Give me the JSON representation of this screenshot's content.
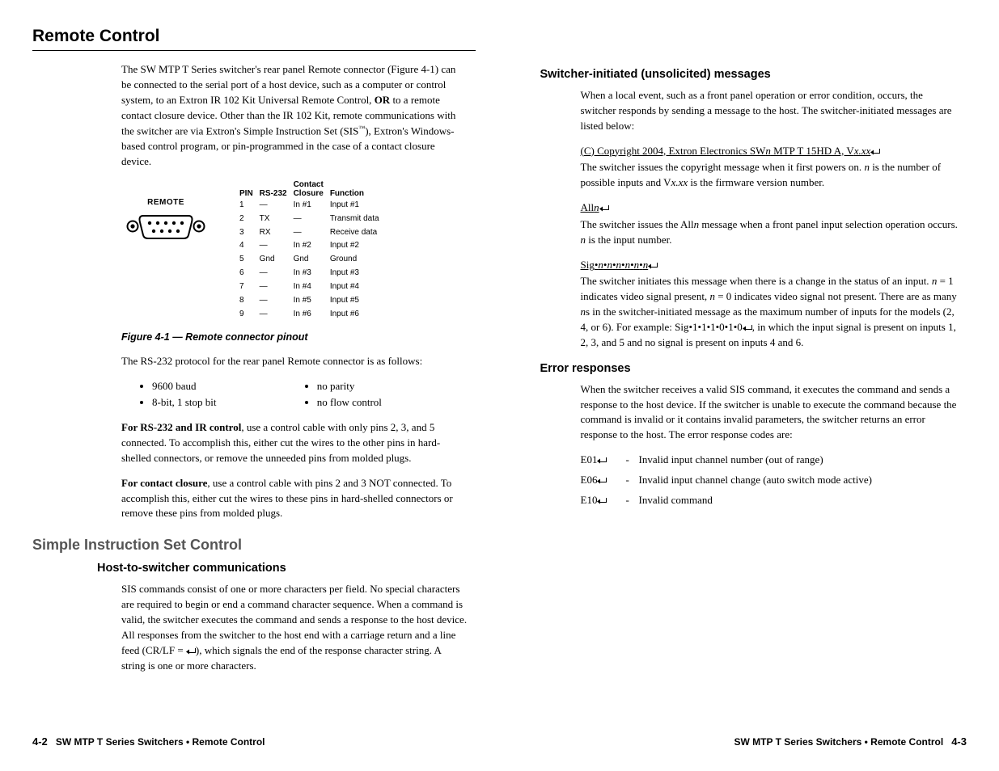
{
  "left": {
    "title": "Remote Control",
    "intro_a": "The SW MTP T Series switcher's rear panel Remote connector (Figure 4-1) can be connected to the serial port of a host device, such as a computer or control system, to an Extron IR 102 Kit Universal Remote Control, ",
    "intro_or": "OR",
    "intro_b": " to a remote contact closure device.  Other than the IR 102 Kit, remote communications with the switcher are via Extron's Simple Instruction Set (SIS",
    "intro_c": "), Extron's Windows-based control program, or pin-programmed in the case of a contact closure device.",
    "remote_label": "REMOTE",
    "pin_headers": {
      "pin": "PIN",
      "rs232": "RS-232",
      "cc1": "Contact",
      "cc2": "Closure",
      "fn": "Function"
    },
    "pins": [
      {
        "n": "1",
        "r": "—",
        "c": "In #1",
        "f": "Input #1"
      },
      {
        "n": "2",
        "r": "TX",
        "c": "—",
        "f": "Transmit data"
      },
      {
        "n": "3",
        "r": "RX",
        "c": "—",
        "f": "Receive data"
      },
      {
        "n": "4",
        "r": "—",
        "c": "In #2",
        "f": "Input #2"
      },
      {
        "n": "5",
        "r": "Gnd",
        "c": "Gnd",
        "f": "Ground"
      },
      {
        "n": "6",
        "r": "—",
        "c": "In #3",
        "f": "Input #3"
      },
      {
        "n": "7",
        "r": "—",
        "c": "In #4",
        "f": "Input #4"
      },
      {
        "n": "8",
        "r": "—",
        "c": "In #5",
        "f": "Input #5"
      },
      {
        "n": "9",
        "r": "—",
        "c": "In #6",
        "f": "Input #6"
      }
    ],
    "figcap": "Figure 4-1 — Remote connector pinout",
    "proto_intro": "The RS-232 protocol for the rear panel Remote connector is as follows:",
    "proto": {
      "a": "9600 baud",
      "b": "8-bit, 1 stop bit",
      "c": "no parity",
      "d": "no flow control"
    },
    "rs232_b": "For RS-232 and IR control",
    "rs232_t": ", use a control cable with only pins 2, 3, and 5 connected.  To accomplish this, either cut the wires to the other pins in hard-shelled connectors, or remove the unneeded pins from molded plugs.",
    "cc_b": "For contact closure",
    "cc_t": ", use a control cable with pins 2 and 3 NOT connected.  To accomplish this, either cut the wires to these pins in hard-shelled connectors or remove these pins from molded plugs.",
    "sis_h2": "Simple Instruction Set Control",
    "sis_h3": "Host-to-switcher communications",
    "sis_p_a": "SIS commands consist of one or more characters per field.  No special characters are required to begin or end a command character sequence.  When a command is valid, the switcher executes the command and sends a response to the host device.  All responses from the switcher to the host end with a carriage return and a line feed (CR/LF = ",
    "sis_p_b": "), which signals the end of the response character string.  A string is one or more characters.",
    "footer_pn": "4-2",
    "footer_t": "SW MTP T Series Switchers • Remote Control"
  },
  "right": {
    "unsol_h3": "Switcher-initiated (unsolicited) messages",
    "unsol_p1": "When a local event, such as a front panel operation or error condition, occurs, the switcher responds by sending a message to the host.  The switcher-initiated messages are listed below:",
    "copy_u_a": "(C) Copyright 2004, Extron Electronics SW",
    "copy_u_b": " MTP T 15HD A, V",
    "n": "n",
    "xxx": "x.xx",
    "copy_p_a": "The switcher issues the copyright message when it first powers on.  ",
    "copy_p_b": " is the number of possible inputs and V",
    "copy_p_c": " is the firmware version number.",
    "all_u": "All",
    "all_p_a": "The switcher issues the All",
    "all_p_b": " message when a front panel input selection operation occurs.  ",
    "all_p_c": " is the input number.",
    "sig_u_a": "Sig",
    "bullet": "•",
    "sig_p_a": "The switcher initiates this message when there is a change in the status of an input.  ",
    "sig_p_b": " = 1 indicates video signal present, ",
    "sig_p_c": " = 0 indicates video signal not present.  There are as many ",
    "sig_p_d": "s in the switcher-initiated message as the maximum number of inputs for the models (2, 4, or 6).  For example: Sig",
    "sig_ex": "1•1•1•0•1•0",
    "sig_p_e": ", in which the input signal is present on inputs 1, 2, 3, and 5 and no signal is present on inputs 4 and 6.",
    "err_h3": "Error responses",
    "err_p1": "When the switcher receives a valid SIS command, it executes the command and sends a response to the host device.  If the switcher is unable to execute the command because the command is invalid or it contains invalid parameters, the switcher returns an error response to the host.  The error response codes are:",
    "errs": [
      {
        "c": "E01",
        "t": "Invalid input channel number (out of range)"
      },
      {
        "c": "E06",
        "t": "Invalid input channel change (auto switch mode active)"
      },
      {
        "c": "E10",
        "t": "Invalid command"
      }
    ],
    "footer_t": "SW MTP T Series Switchers • Remote Control",
    "footer_pn": "4-3"
  }
}
